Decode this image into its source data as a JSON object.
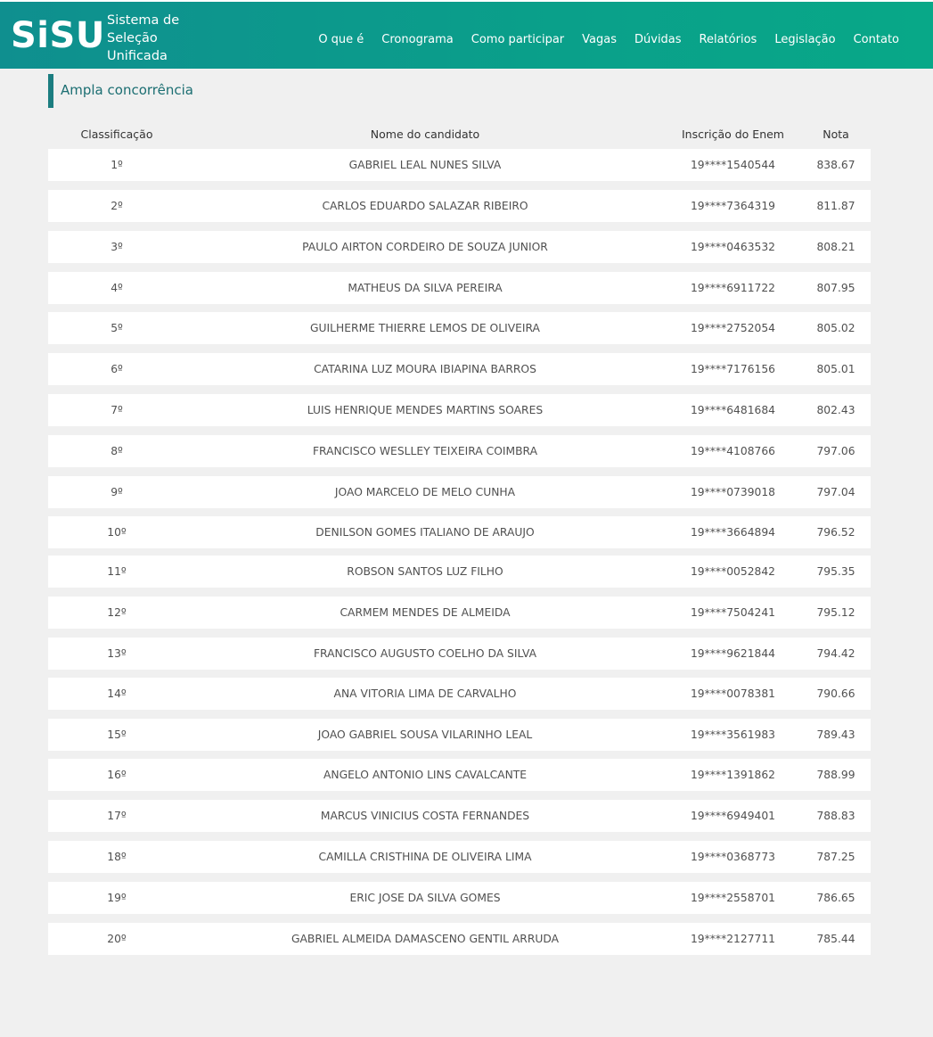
{
  "header": {
    "logo": "SiSU",
    "tagline": "Sistema de Seleção Unificada",
    "nav": [
      "O que é",
      "Cronograma",
      "Como participar",
      "Vagas",
      "Dúvidas",
      "Relatórios",
      "Legislação",
      "Contato"
    ]
  },
  "section_title": "Ampla concorrência",
  "table": {
    "columns": [
      "Classificação",
      "Nome do candidato",
      "Inscrição do Enem",
      "Nota"
    ],
    "rows": [
      [
        "1º",
        "GABRIEL LEAL NUNES SILVA",
        "19****1540544",
        "838.67"
      ],
      [
        "2º",
        "CARLOS EDUARDO SALAZAR RIBEIRO",
        "19****7364319",
        "811.87"
      ],
      [
        "3º",
        "PAULO AIRTON CORDEIRO DE SOUZA JUNIOR",
        "19****0463532",
        "808.21"
      ],
      [
        "4º",
        "MATHEUS DA SILVA PEREIRA",
        "19****6911722",
        "807.95"
      ],
      [
        "5º",
        "GUILHERME THIERRE LEMOS DE OLIVEIRA",
        "19****2752054",
        "805.02"
      ],
      [
        "6º",
        "CATARINA LUZ MOURA IBIAPINA BARROS",
        "19****7176156",
        "805.01"
      ],
      [
        "7º",
        "LUIS HENRIQUE MENDES MARTINS SOARES",
        "19****6481684",
        "802.43"
      ],
      [
        "8º",
        "FRANCISCO WESLLEY TEIXEIRA COIMBRA",
        "19****4108766",
        "797.06"
      ],
      [
        "9º",
        "JOAO MARCELO DE MELO CUNHA",
        "19****0739018",
        "797.04"
      ],
      [
        "10º",
        "DENILSON GOMES ITALIANO DE ARAUJO",
        "19****3664894",
        "796.52"
      ],
      [
        "11º",
        "ROBSON SANTOS LUZ FILHO",
        "19****0052842",
        "795.35"
      ],
      [
        "12º",
        "CARMEM MENDES DE ALMEIDA",
        "19****7504241",
        "795.12"
      ],
      [
        "13º",
        "FRANCISCO AUGUSTO COELHO DA SILVA",
        "19****9621844",
        "794.42"
      ],
      [
        "14º",
        "ANA VITORIA LIMA DE CARVALHO",
        "19****0078381",
        "790.66"
      ],
      [
        "15º",
        "JOAO GABRIEL SOUSA VILARINHO LEAL",
        "19****3561983",
        "789.43"
      ],
      [
        "16º",
        "ANGELO ANTONIO LINS CAVALCANTE",
        "19****1391862",
        "788.99"
      ],
      [
        "17º",
        "MARCUS VINICIUS COSTA FERNANDES",
        "19****6949401",
        "788.83"
      ],
      [
        "18º",
        "CAMILLA CRISTHINA DE OLIVEIRA LIMA",
        "19****0368773",
        "787.25"
      ],
      [
        "19º",
        "ERIC JOSE DA SILVA GOMES",
        "19****2558701",
        "786.65"
      ],
      [
        "20º",
        "GABRIEL ALMEIDA DAMASCENO GENTIL ARRUDA",
        "19****2127711",
        "785.44"
      ]
    ]
  },
  "colors": {
    "header_start": "#0f8f8f",
    "header_end": "#08a888",
    "accent": "#1b7d80"
  }
}
